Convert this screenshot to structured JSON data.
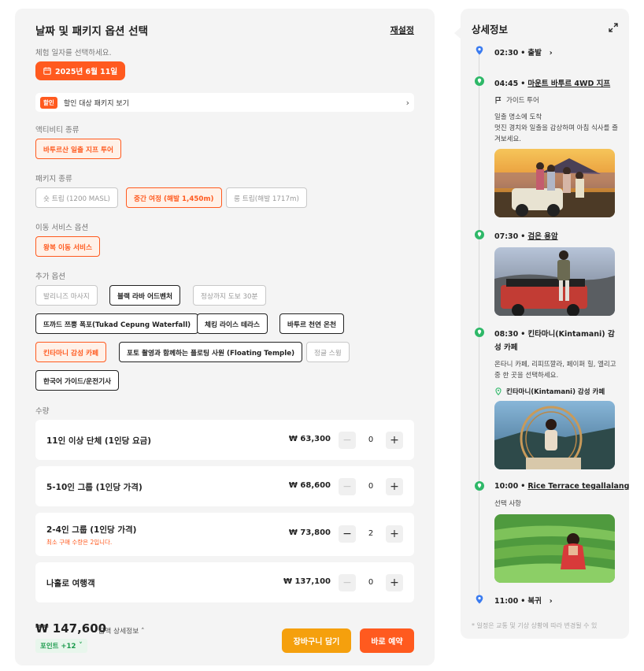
{
  "left": {
    "title": "날짜 및 패키지 옵션 선택",
    "reset": "재설정",
    "date_prompt": "체험 일자를 선택하세요.",
    "date": "2025년 6월 11일",
    "discount": {
      "tag": "할인",
      "text": "할인 대상 패키지 보기"
    },
    "activity": {
      "label": "액티비티 종류",
      "options": [
        "바투르산 일출 지프 투어"
      ]
    },
    "package": {
      "label": "패키지 종류",
      "options": [
        "숏 트립 (1200 MASL)",
        "중간 여정 (해발 1,450m)",
        "롱 트립(해발 1717m)"
      ]
    },
    "transport": {
      "label": "이동 서비스 옵션",
      "options": [
        "왕복 이동 서비스"
      ]
    },
    "extra": {
      "label": "추가 옵션",
      "options": [
        "발리니즈 마사지",
        "블랙 라바 어드벤처",
        "정상까지 도보 30분",
        "뜨까드 쯔뿡 폭포(Tukad Cepung Waterfall)",
        "체킹 라이스 테라스",
        "바투르 천연 온천",
        "킨타마니 감성 카페",
        "포토 촬영과 함께하는 플로팅 사원 (Floating Temple)",
        "정글 스윙",
        "한국어 가이드/운전기사"
      ]
    },
    "quantity": {
      "label": "수량",
      "rows": [
        {
          "name": "11인 이상 단체 (1인당 요금)",
          "price": "₩ 63,300",
          "count": "0",
          "note": ""
        },
        {
          "name": "5-10인 그룹 (1인당 가격)",
          "price": "₩ 68,600",
          "count": "0",
          "note": ""
        },
        {
          "name": "2-4인 그룹 (1인당 가격)",
          "price": "₩ 73,800",
          "count": "2",
          "note": "최소 구매 수량은 2입니다."
        },
        {
          "name": "나홀로 여행객",
          "price": "₩ 137,100",
          "count": "0",
          "note": ""
        }
      ]
    },
    "total": "₩ 147,600",
    "total_detail": "금액 상세정보",
    "points": "포인트 +12",
    "cart": "장바구니 담기",
    "book": "바로 예약"
  },
  "right": {
    "title": "상세정보",
    "stops": [
      {
        "time": "02:30",
        "name": "출발"
      },
      {
        "time": "04:45",
        "name": "마운트 바투르 4WD 지프",
        "guide": "가이드 투어",
        "desc": "일출 명소에 도착\n멋진 경치와 일출을 감상하며 아침 식사를 즐겨보세요."
      },
      {
        "time": "07:30",
        "name": "검은 용암"
      },
      {
        "time": "08:30",
        "name": "킨타마니(Kintamani) 감성 카페",
        "desc": "온타니 카페, 리피뜨깔라, 페이퍼 힐, 엘리고 중 한 곳을 선택하세요.",
        "sub": "킨타마니(Kintamani) 감성 카페"
      },
      {
        "time": "10:00",
        "name": "Rice Terrace tegallalang",
        "desc": "선택 사항"
      },
      {
        "time": "11:00",
        "name": "복귀"
      }
    ],
    "footnote": "* 일정은 교통 및 기상 상황에 따라 변경될 수 있"
  },
  "colors": {
    "accent": "#ff5a1f",
    "cart": "#f5a00d",
    "points": "#1a9a4b",
    "pin_blue": "#3a7bf0",
    "pin_green": "#2eb868"
  },
  "icons": [
    "calendar-icon",
    "chevron-right-icon",
    "expand-icon",
    "location-pin-icon",
    "flag-icon",
    "chevron-up-icon",
    "chevron-down-icon"
  ]
}
